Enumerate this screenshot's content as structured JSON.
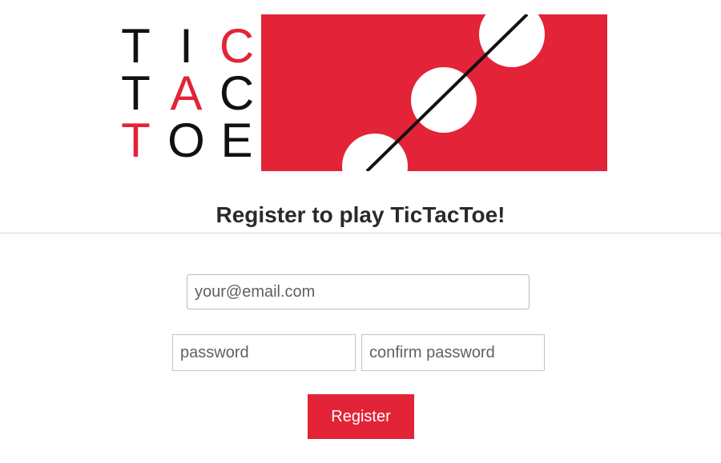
{
  "logo": {
    "rows": [
      [
        {
          "ch": "T",
          "red": false
        },
        {
          "ch": "I",
          "red": false
        },
        {
          "ch": "C",
          "red": true
        }
      ],
      [
        {
          "ch": "T",
          "red": false
        },
        {
          "ch": "A",
          "red": true
        },
        {
          "ch": "C",
          "red": false
        }
      ],
      [
        {
          "ch": "T",
          "red": true
        },
        {
          "ch": "O",
          "red": false
        },
        {
          "ch": "E",
          "red": false
        }
      ]
    ],
    "colors": {
      "accent": "#e32338",
      "dark": "#111111"
    }
  },
  "page": {
    "title": "Register to play TicTacToe!"
  },
  "form": {
    "email_placeholder": "your@email.com",
    "password_placeholder": "password",
    "confirm_placeholder": "confirm password",
    "submit_label": "Register"
  },
  "colors": {
    "accent": "#e32338",
    "divider": "#d7d7d7"
  }
}
